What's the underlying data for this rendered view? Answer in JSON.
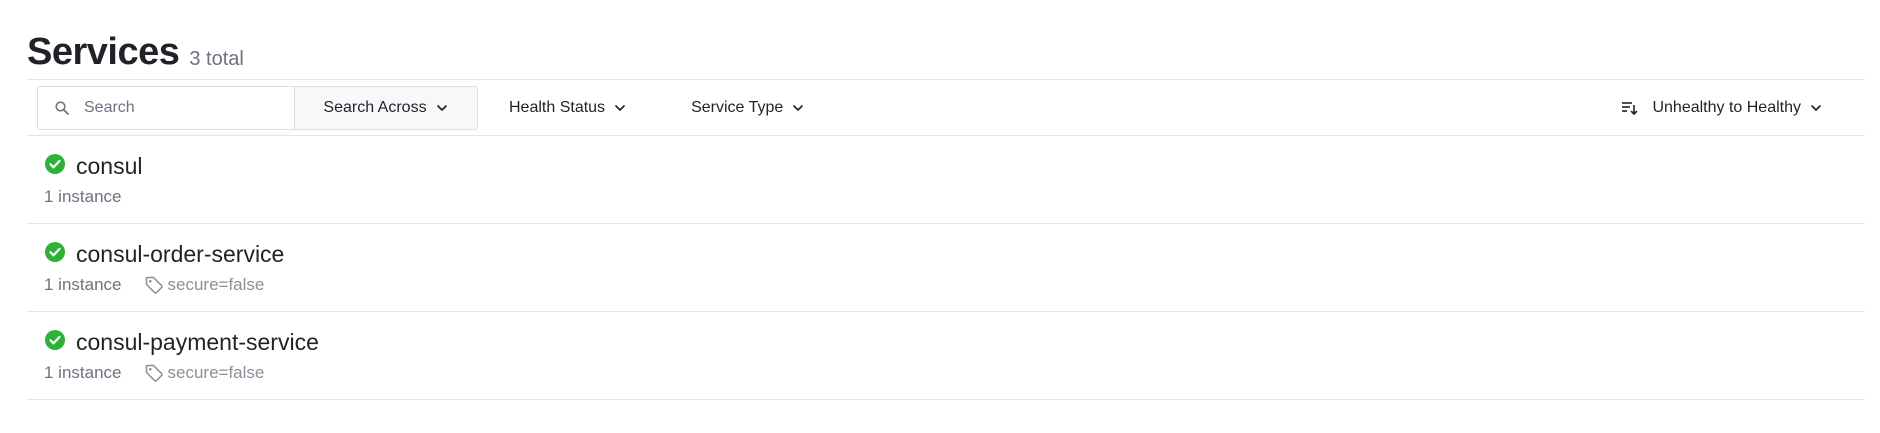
{
  "page": {
    "title": "Services",
    "count_label": "3 total"
  },
  "toolbar": {
    "search": {
      "placeholder": "Search",
      "value": ""
    },
    "search_across_label": "Search Across",
    "health_status_label": "Health Status",
    "service_type_label": "Service Type",
    "sort_label": "Unhealthy to Healthy"
  },
  "icons": {
    "search": "search-icon",
    "chevron": "chevron-down-icon",
    "sort": "sort-icon",
    "health": "check-circle-icon",
    "tag": "tag-icon"
  },
  "colors": {
    "healthy": "#2eb039",
    "text_primary": "#1f2328",
    "text_muted": "#6b7280",
    "border": "#e3e5e8"
  },
  "services": [
    {
      "name": "consul",
      "health": "passing",
      "instances": "1 instance",
      "tags": []
    },
    {
      "name": "consul-order-service",
      "health": "passing",
      "instances": "1 instance",
      "tags": [
        "secure=false"
      ]
    },
    {
      "name": "consul-payment-service",
      "health": "passing",
      "instances": "1 instance",
      "tags": [
        "secure=false"
      ]
    }
  ]
}
